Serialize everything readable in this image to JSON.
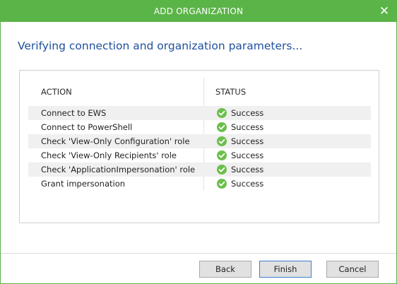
{
  "window": {
    "title": "ADD ORGANIZATION",
    "close_label": "✕"
  },
  "heading": "Verifying connection and organization parameters...",
  "table": {
    "columns": {
      "action": "ACTION",
      "status": "STATUS"
    },
    "rows": [
      {
        "action": "Connect to EWS",
        "status": "Success"
      },
      {
        "action": "Connect to PowerShell",
        "status": "Success"
      },
      {
        "action": "Check 'View-Only Configuration' role",
        "status": "Success"
      },
      {
        "action": "Check 'View-Only Recipients' role",
        "status": "Success"
      },
      {
        "action": "Check 'ApplicationImpersonation' role",
        "status": "Success"
      },
      {
        "action": "Grant impersonation",
        "status": "Success"
      }
    ],
    "status_icon": "check-circle-icon"
  },
  "buttons": {
    "back": "Back",
    "finish": "Finish",
    "cancel": "Cancel"
  },
  "colors": {
    "title_bar": "#5bb448",
    "heading_text": "#1e4f9e",
    "success_icon": "#6cbf4b",
    "alt_row": "#f0f0f0"
  }
}
